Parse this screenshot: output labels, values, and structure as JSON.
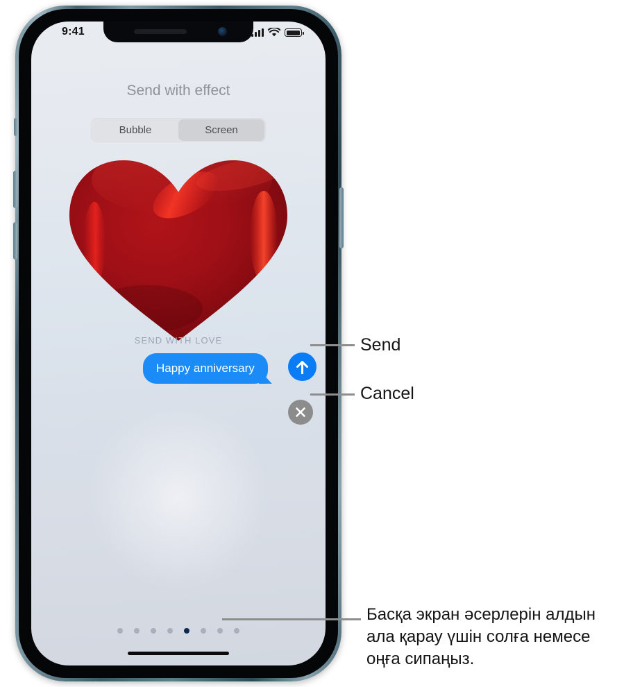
{
  "device": {
    "status_bar": {
      "time": "9:41",
      "icons": [
        "cellular-signal-icon",
        "wifi-icon",
        "battery-icon"
      ],
      "battery_level_percent": 100
    },
    "notch_icons": [
      "earpiece-speaker-icon",
      "front-camera-icon"
    ],
    "side_buttons": [
      "silent-switch",
      "volume-up-button",
      "volume-down-button",
      "power-button"
    ],
    "home_indicator": "home-indicator"
  },
  "screen": {
    "title": "Send with effect",
    "segmented_control": {
      "options": [
        "Bubble",
        "Screen"
      ],
      "selected": "Screen"
    },
    "effect_preview": {
      "name": "Love screen effect",
      "graphic": "red-balloon-heart",
      "caption": "SEND WITH LOVE"
    },
    "message": {
      "text": "Happy anniversary",
      "bubble_color": "#1b8cf7",
      "text_color": "#ffffff"
    },
    "actions": {
      "send": {
        "icon": "arrow-up-icon",
        "color": "#0a7cf5"
      },
      "cancel": {
        "icon": "close-x-icon",
        "color": "#8c8c8c"
      }
    },
    "page_dots": {
      "total": 8,
      "active_index": 5,
      "active_color": "#10284b",
      "inactive_color": "#a9b0bb"
    }
  },
  "callouts": [
    {
      "label": "Send"
    },
    {
      "label": "Cancel"
    },
    {
      "label": "Басқа экран әсерлерін алдын ала қарау үшін солға немесе оңға сипаңыз."
    }
  ]
}
